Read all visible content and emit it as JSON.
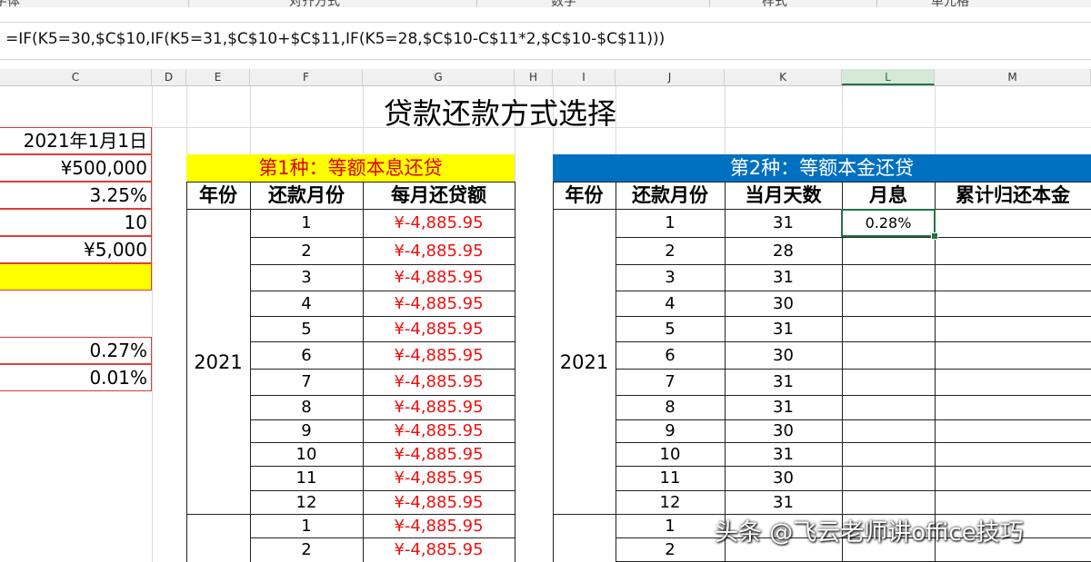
{
  "ribbon": {
    "groups": [
      "字体",
      "对齐方式",
      "数字",
      "样式",
      "单元格"
    ]
  },
  "formula_bar": {
    "formula": "=IF(K5=30,$C$10,IF(K5=31,$C$10+$C$11,IF(K5=28,$C$10-C$11*2,$C$10-$C$11)))"
  },
  "columns": [
    "C",
    "D",
    "E",
    "F",
    "G",
    "H",
    "I",
    "J",
    "K",
    "L",
    "M"
  ],
  "selected_column": "L",
  "sheet_title": "贷款还款方式选择",
  "params": [
    "2021年1月1日",
    "¥500,000",
    "3.25%",
    "10",
    "¥5,000",
    "",
    "0.27%",
    "0.01%"
  ],
  "table1": {
    "banner": "第1种：等额本息还贷",
    "headers": [
      "年份",
      "还款月份",
      "每月还贷额"
    ],
    "year": "2021",
    "months": [
      "1",
      "2",
      "3",
      "4",
      "5",
      "6",
      "7",
      "8",
      "9",
      "10",
      "11",
      "12",
      "1",
      "2"
    ],
    "amount": "¥-4,885.95"
  },
  "table2": {
    "banner": "第2种：等额本金还贷",
    "headers": [
      "年份",
      "还款月份",
      "当月天数",
      "月息",
      "累计归还本金"
    ],
    "year": "2021",
    "months": [
      "1",
      "2",
      "3",
      "4",
      "5",
      "6",
      "7",
      "8",
      "9",
      "10",
      "11",
      "12",
      "1",
      "2"
    ],
    "days": [
      "31",
      "28",
      "31",
      "30",
      "31",
      "30",
      "31",
      "31",
      "30",
      "31",
      "30",
      "31"
    ],
    "interest_first": "0.28%"
  },
  "watermark": "头条 @飞云老师讲office技巧",
  "colors": {
    "accent": "#217346",
    "banner1_bg": "#ffff00",
    "banner1_text": "#e00000",
    "banner2_bg": "#0070c0",
    "amount_red": "#ee1010",
    "param_border": "#e23a3a"
  }
}
